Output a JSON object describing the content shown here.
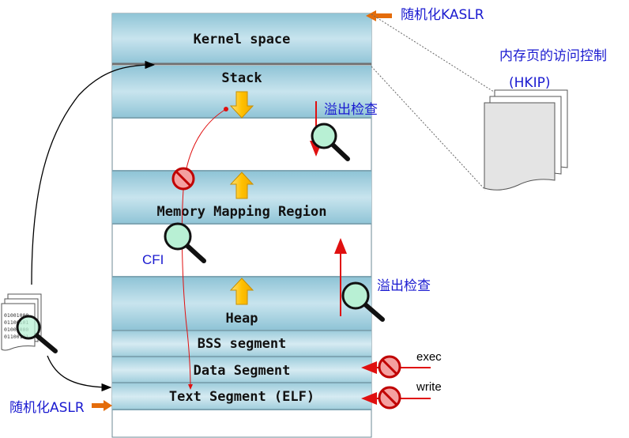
{
  "segments": {
    "kernel": "Kernel space",
    "stack": "Stack",
    "mmap": "Memory Mapping Region",
    "heap": "Heap",
    "bss": "BSS segment",
    "data": "Data Segment",
    "text": "Text Segment (ELF)"
  },
  "annotations": {
    "kaslr": "随机化KASLR",
    "hkip_line1": "内存页的访问控制",
    "hkip_line2": "(HKIP)",
    "overflow_top": "溢出检查",
    "overflow_bottom": "溢出检查",
    "cfi": "CFI",
    "aslr": "随机化ASLR",
    "exec": "exec",
    "write": "write"
  },
  "binary_icon": {
    "lines": [
      "01001000",
      "01100101",
      "01001000",
      "01100101"
    ]
  },
  "colors": {
    "band": "#a9d3e0",
    "band_light": "#d3eaf2",
    "annotation_text": "#1a1ad0",
    "orange_arrow": "#e46c0a",
    "red": "#e01010",
    "yellow_arrow": "#ffc000",
    "magnifier_lens": "#b8f0d4"
  },
  "icons": {
    "kaslr_arrow": "orange-left-arrow-icon",
    "aslr_arrow": "orange-right-arrow-icon",
    "magnifier": "magnifier-icon",
    "prohibited": "prohibited-icon",
    "documents": "document-stack-icon",
    "growth_arrow": "yellow-arrow-icon"
  }
}
